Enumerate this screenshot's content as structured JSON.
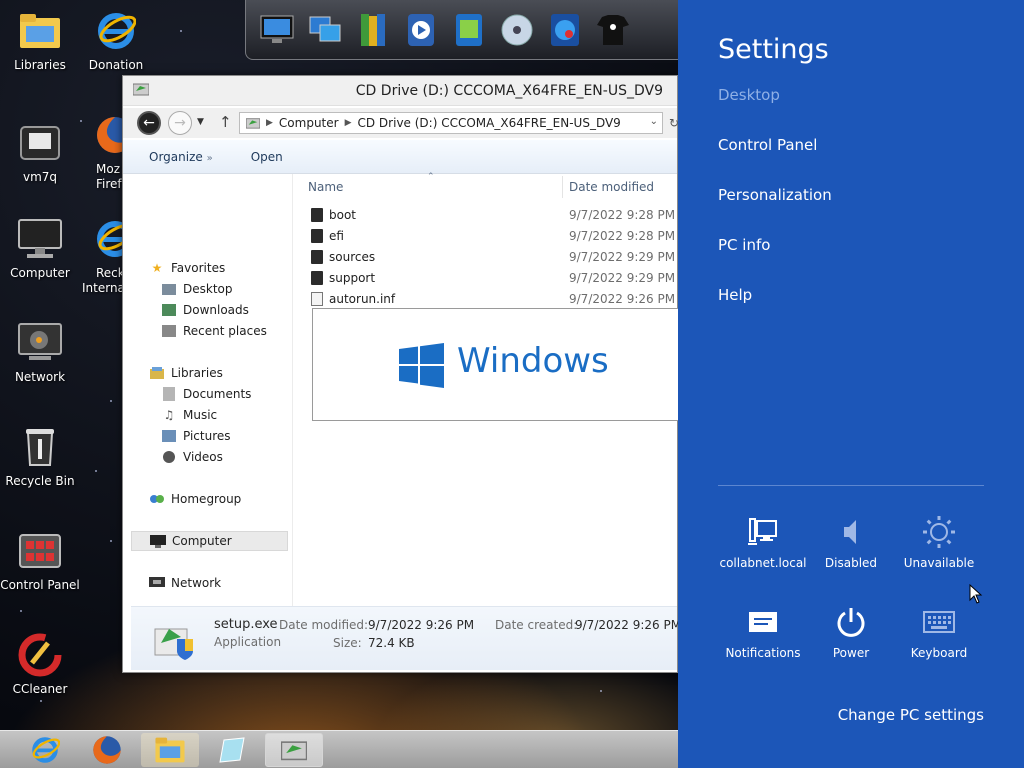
{
  "desktop": {
    "icons": [
      {
        "label": "Libraries",
        "icon": "libraries-folder-icon"
      },
      {
        "label": "Donation",
        "icon": "internet-explorer-icon"
      },
      {
        "label": "vm7q",
        "icon": "media-player-icon"
      },
      {
        "label": "Mozilla Firefox",
        "icon": "firefox-icon",
        "visible_lines": [
          "Moz",
          "Firef"
        ]
      },
      {
        "label": "Computer",
        "icon": "computer-monitor-icon"
      },
      {
        "label": "Reckon Internet",
        "icon": "internet-explorer-icon",
        "visible_lines": [
          "Recko",
          "Internat"
        ]
      },
      {
        "label": "Network",
        "icon": "network-dish-icon"
      },
      {
        "label": "Recycle Bin",
        "icon": "recycle-bin-icon"
      },
      {
        "label": "Control Panel",
        "icon": "control-panel-icon"
      },
      {
        "label": "CCleaner",
        "icon": "ccleaner-icon"
      }
    ]
  },
  "dock": {
    "items": [
      "monitor-icon",
      "network-computers-icon",
      "library-books-icon",
      "media-player-icon",
      "media-folder-icon",
      "cd-disc-icon",
      "globe-icon",
      "tshirt-icon"
    ]
  },
  "explorer": {
    "title": "CD Drive (D:) CCCOMA_X64FRE_EN-US_DV9",
    "address": {
      "segments": [
        "Computer",
        "CD Drive (D:) CCCOMA_X64FRE_EN-US_DV9"
      ]
    },
    "command_bar": {
      "organize": "Organize",
      "organize_chevron": "»",
      "open": "Open"
    },
    "nav": {
      "favorites": "Favorites",
      "desktop": "Desktop",
      "downloads": "Downloads",
      "recent_places": "Recent places",
      "libraries": "Libraries",
      "documents": "Documents",
      "music": "Music",
      "pictures": "Pictures",
      "videos": "Videos",
      "homegroup": "Homegroup",
      "computer": "Computer",
      "network": "Network"
    },
    "columns": {
      "name": "Name",
      "date_modified": "Date modified"
    },
    "files": [
      {
        "name": "boot",
        "type": "folder",
        "date": "9/7/2022 9:28 PM"
      },
      {
        "name": "efi",
        "type": "folder",
        "date": "9/7/2022 9:28 PM"
      },
      {
        "name": "sources",
        "type": "folder",
        "date": "9/7/2022 9:29 PM"
      },
      {
        "name": "support",
        "type": "folder",
        "date": "9/7/2022 9:29 PM"
      },
      {
        "name": "autorun.inf",
        "type": "inf",
        "date": "9/7/2022 9:26 PM"
      }
    ],
    "details": {
      "filename": "setup.exe",
      "filetype": "Application",
      "modified_label": "Date modified:",
      "modified_value": "9/7/2022 9:26 PM",
      "size_label": "Size:",
      "size_value": "72.4 KB",
      "created_label": "Date created:",
      "created_value": "9/7/2022 9:26 PM"
    }
  },
  "splash": {
    "text": "Windows",
    "color": "#1a6dc4"
  },
  "settings_charm": {
    "title": "Settings",
    "context": "Desktop",
    "links": [
      "Control Panel",
      "Personalization",
      "PC info",
      "Help"
    ],
    "tiles": [
      {
        "label": "collabnet.local",
        "icon": "network-icon"
      },
      {
        "label": "Disabled",
        "icon": "volume-icon"
      },
      {
        "label": "Unavailable",
        "icon": "brightness-icon"
      },
      {
        "label": "Notifications",
        "icon": "notifications-icon"
      },
      {
        "label": "Power",
        "icon": "power-icon"
      },
      {
        "label": "Keyboard",
        "icon": "keyboard-icon"
      }
    ],
    "change_pc_settings": "Change PC settings",
    "background": "#1c56b8"
  },
  "taskbar": {
    "items": [
      "internet-explorer-icon",
      "firefox-icon",
      "file-explorer-icon",
      "glass-app-icon",
      "cd-drive-window-icon"
    ],
    "active_index": 4
  }
}
